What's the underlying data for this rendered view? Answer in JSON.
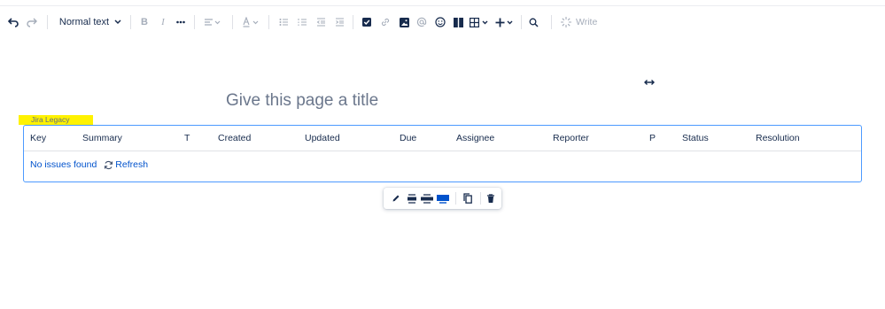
{
  "toolbar": {
    "text_style": "Normal text",
    "write_label": "Write",
    "icons": [
      "undo-icon",
      "redo-icon",
      "bold-icon",
      "italic-icon",
      "more-icon",
      "align-icon",
      "text-color-icon",
      "bullet-list-icon",
      "numbered-list-icon",
      "outdent-icon",
      "indent-icon",
      "task-icon",
      "link-icon",
      "image-icon",
      "mention-icon",
      "emoji-icon",
      "layout-icon",
      "table-icon",
      "insert-icon",
      "search-icon",
      "ai-write-icon"
    ]
  },
  "page": {
    "title_placeholder": "Give this page a title"
  },
  "macro": {
    "label": "Jira Legacy",
    "accent_color": "#4c9aff",
    "highlight_color": "#fff200",
    "columns": [
      "Key",
      "Summary",
      "T",
      "Created",
      "Updated",
      "Due",
      "Assignee",
      "Reporter",
      "P",
      "Status",
      "Resolution"
    ],
    "empty_message": "No issues found",
    "refresh_label": "Refresh"
  },
  "floating_toolbar": {
    "icons": [
      "edit-icon",
      "align-center-icon",
      "wide-icon",
      "full-width-icon",
      "copy-icon",
      "delete-icon"
    ],
    "active": "full-width-icon"
  }
}
